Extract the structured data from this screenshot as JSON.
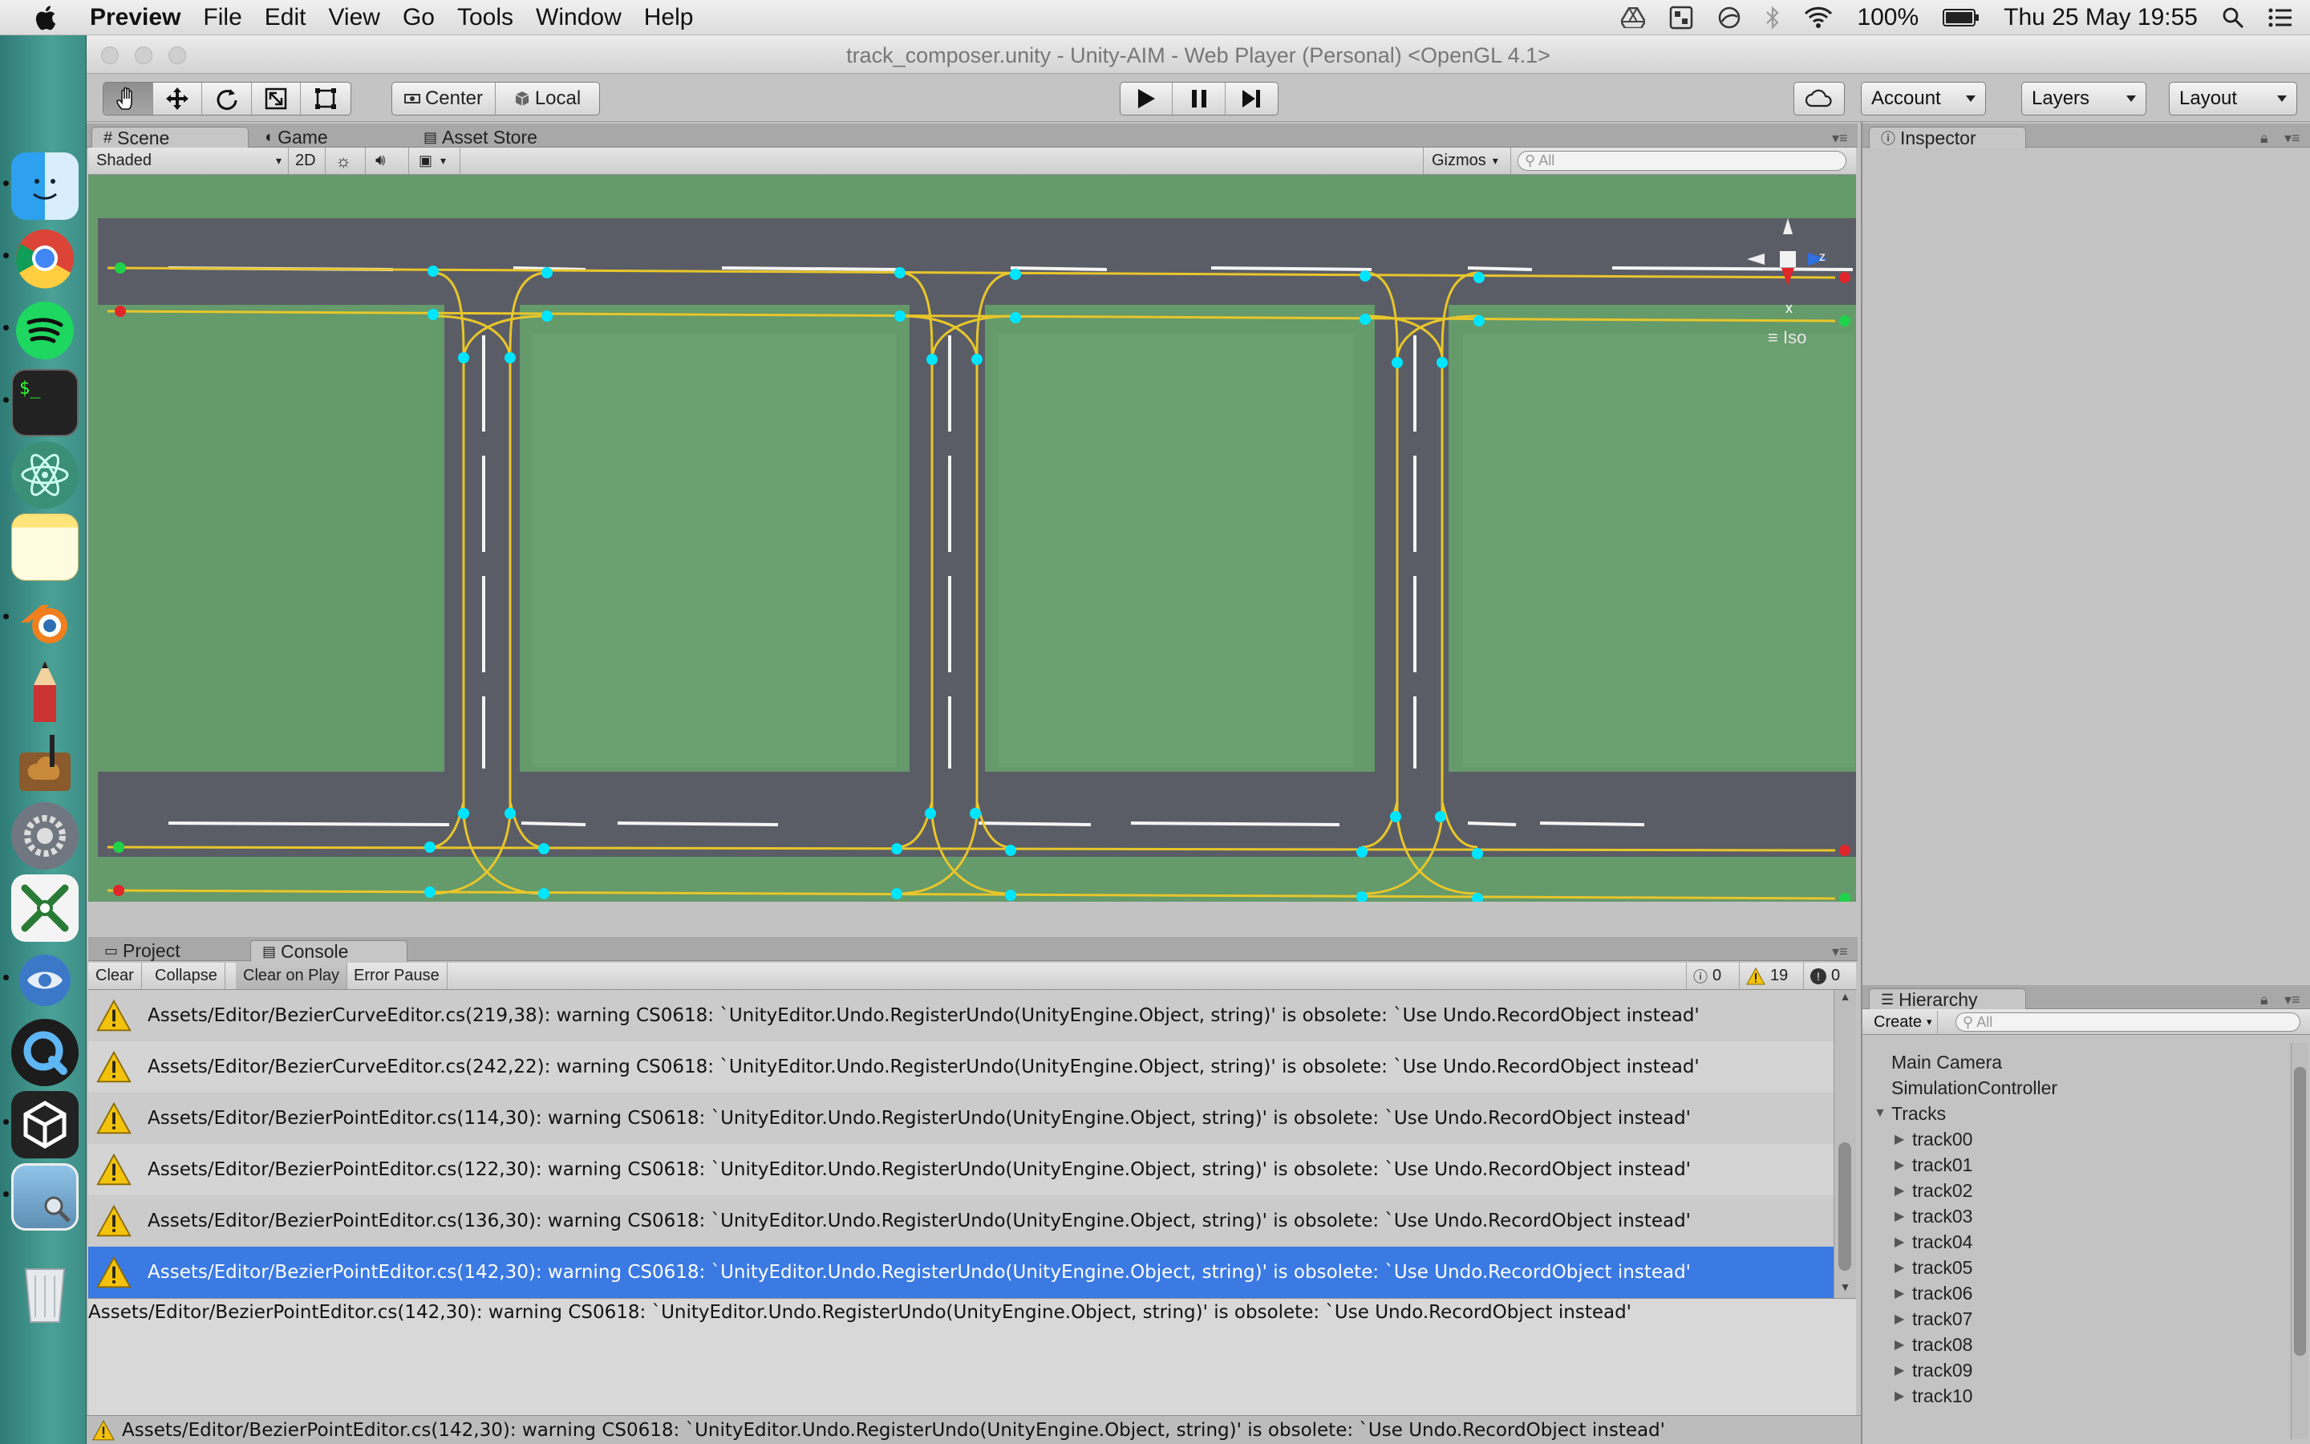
{
  "menubar": {
    "app_name": "Preview",
    "menus": [
      "File",
      "Edit",
      "View",
      "Go",
      "Tools",
      "Window",
      "Help"
    ],
    "battery": "100%",
    "clock": "Thu 25 May  19:55"
  },
  "window": {
    "title": "track_composer.unity - Unity-AIM - Web Player (Personal) <OpenGL 4.1>"
  },
  "toolbar": {
    "pivot_label": "Center",
    "space_label": "Local",
    "account_label": "Account",
    "layers_label": "Layers",
    "layout_label": "Layout"
  },
  "scene_panel": {
    "tabs": [
      "Scene",
      "Game",
      "Asset Store"
    ],
    "shading_mode": "Shaded",
    "mode_2d": "2D",
    "gizmos_label": "Gizmos",
    "search_placeholder": "All",
    "gizmo_axis_x": "x",
    "gizmo_axis_z": "z",
    "projection_label": "Iso",
    "colors": {
      "grass": "#659a6a",
      "road": "#5a5d66",
      "lane": "#e8c62a",
      "node": "#00e5ff",
      "start": "#1ed34a",
      "end": "#e0262a"
    }
  },
  "inspector": {
    "tab_label": "Inspector"
  },
  "hierarchy": {
    "tab_label": "Hierarchy",
    "create_label": "Create",
    "search_placeholder": "All",
    "items": [
      {
        "label": "Main Camera",
        "level": 0,
        "arrow": ""
      },
      {
        "label": "SimulationController",
        "level": 0,
        "arrow": ""
      },
      {
        "label": "Tracks",
        "level": 0,
        "arrow": "▼"
      },
      {
        "label": "track00",
        "level": 1,
        "arrow": "▶"
      },
      {
        "label": "track01",
        "level": 1,
        "arrow": "▶"
      },
      {
        "label": "track02",
        "level": 1,
        "arrow": "▶"
      },
      {
        "label": "track03",
        "level": 1,
        "arrow": "▶"
      },
      {
        "label": "track04",
        "level": 1,
        "arrow": "▶"
      },
      {
        "label": "track05",
        "level": 1,
        "arrow": "▶"
      },
      {
        "label": "track06",
        "level": 1,
        "arrow": "▶"
      },
      {
        "label": "track07",
        "level": 1,
        "arrow": "▶"
      },
      {
        "label": "track08",
        "level": 1,
        "arrow": "▶"
      },
      {
        "label": "track09",
        "level": 1,
        "arrow": "▶"
      },
      {
        "label": "track10",
        "level": 1,
        "arrow": "▶"
      }
    ]
  },
  "console": {
    "tabs": [
      "Project",
      "Console"
    ],
    "buttons": [
      "Clear",
      "Collapse",
      "Clear on Play",
      "Error Pause"
    ],
    "info_count": "0",
    "warning_count": "19",
    "error_count": "0",
    "messages": [
      "Assets/Editor/BezierCurveEditor.cs(219,38): warning CS0618: `UnityEditor.Undo.RegisterUndo(UnityEngine.Object, string)' is obsolete: `Use Undo.RecordObject instead'",
      "Assets/Editor/BezierCurveEditor.cs(242,22): warning CS0618: `UnityEditor.Undo.RegisterUndo(UnityEngine.Object, string)' is obsolete: `Use Undo.RecordObject instead'",
      "Assets/Editor/BezierPointEditor.cs(114,30): warning CS0618: `UnityEditor.Undo.RegisterUndo(UnityEngine.Object, string)' is obsolete: `Use Undo.RecordObject instead'",
      "Assets/Editor/BezierPointEditor.cs(122,30): warning CS0618: `UnityEditor.Undo.RegisterUndo(UnityEngine.Object, string)' is obsolete: `Use Undo.RecordObject instead'",
      "Assets/Editor/BezierPointEditor.cs(136,30): warning CS0618: `UnityEditor.Undo.RegisterUndo(UnityEngine.Object, string)' is obsolete: `Use Undo.RecordObject instead'",
      "Assets/Editor/BezierPointEditor.cs(142,30): warning CS0618: `UnityEditor.Undo.RegisterUndo(UnityEngine.Object, string)' is obsolete: `Use Undo.RecordObject instead'"
    ],
    "detail": "Assets/Editor/BezierPointEditor.cs(142,30): warning CS0618: `UnityEditor.Undo.RegisterUndo(UnityEngine.Object, string)' is obsolete: `Use Undo.RecordObject instead'"
  },
  "statusbar": {
    "message": "Assets/Editor/BezierPointEditor.cs(142,30): warning CS0618: `UnityEditor.Undo.RegisterUndo(UnityEngine.Object, string)' is obsolete: `Use Undo.RecordObject instead'"
  },
  "dock": {
    "items": [
      "finder-icon",
      "chrome-icon",
      "spotify-icon",
      "terminal-icon",
      "atom-icon",
      "notes-icon",
      "blender-icon",
      "pencil-icon",
      "garageband-icon",
      "system-preferences-icon",
      "xcode-icon",
      "remote-desktop-icon",
      "quicktime-icon",
      "unity-icon",
      "preview-icon",
      "trash-icon"
    ]
  }
}
